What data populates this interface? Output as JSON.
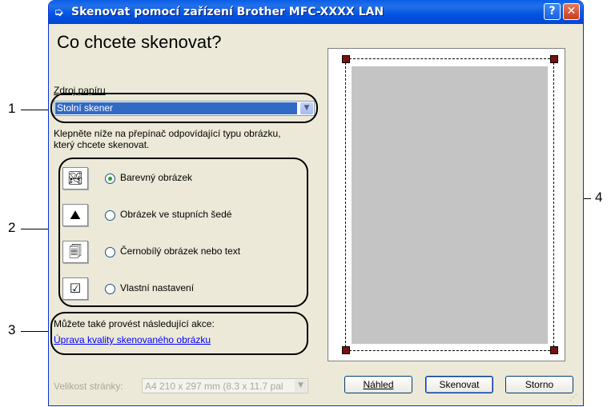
{
  "window": {
    "title": "Skenovat pomocí zařízení Brother  MFC-XXXX  LAN",
    "help_button": "?",
    "close_button": "✕"
  },
  "main": {
    "heading": "Co chcete skenovat?",
    "paper_source_label": "Zdroj papíru",
    "paper_source_value": "Stolní skener",
    "instruction_line1": "Klepněte níže na přepínač odpovídající typu obrázku,",
    "instruction_line2": "který chcete skenovat.",
    "scan_types": [
      {
        "label": "Barevný obrázek",
        "selected": true,
        "icon": "color-photo-icon"
      },
      {
        "label": "Obrázek ve stupních šedé",
        "selected": false,
        "icon": "grayscale-photo-icon"
      },
      {
        "label": "Černobílý obrázek nebo text",
        "selected": false,
        "icon": "bw-text-icon"
      },
      {
        "label": "Vlastní nastavení",
        "selected": false,
        "icon": "custom-settings-icon"
      }
    ],
    "also_label": "Můžete také provést následující akce:",
    "quality_link": "Úprava kvality skenovaného obrázku"
  },
  "footer": {
    "page_size_label": "Velikost stránky:",
    "page_size_value": "A4 210 x 297 mm (8.3 x 11.7 pal",
    "preview_button": "Náhled",
    "scan_button": "Skenovat",
    "cancel_button": "Storno"
  },
  "callouts": {
    "c1": "1",
    "c2": "2",
    "c3": "3",
    "c4": "4"
  },
  "colors": {
    "titlebar": "#0054e3",
    "selection": "#316ac5",
    "link": "#0000ff",
    "handle": "#7a1010"
  }
}
